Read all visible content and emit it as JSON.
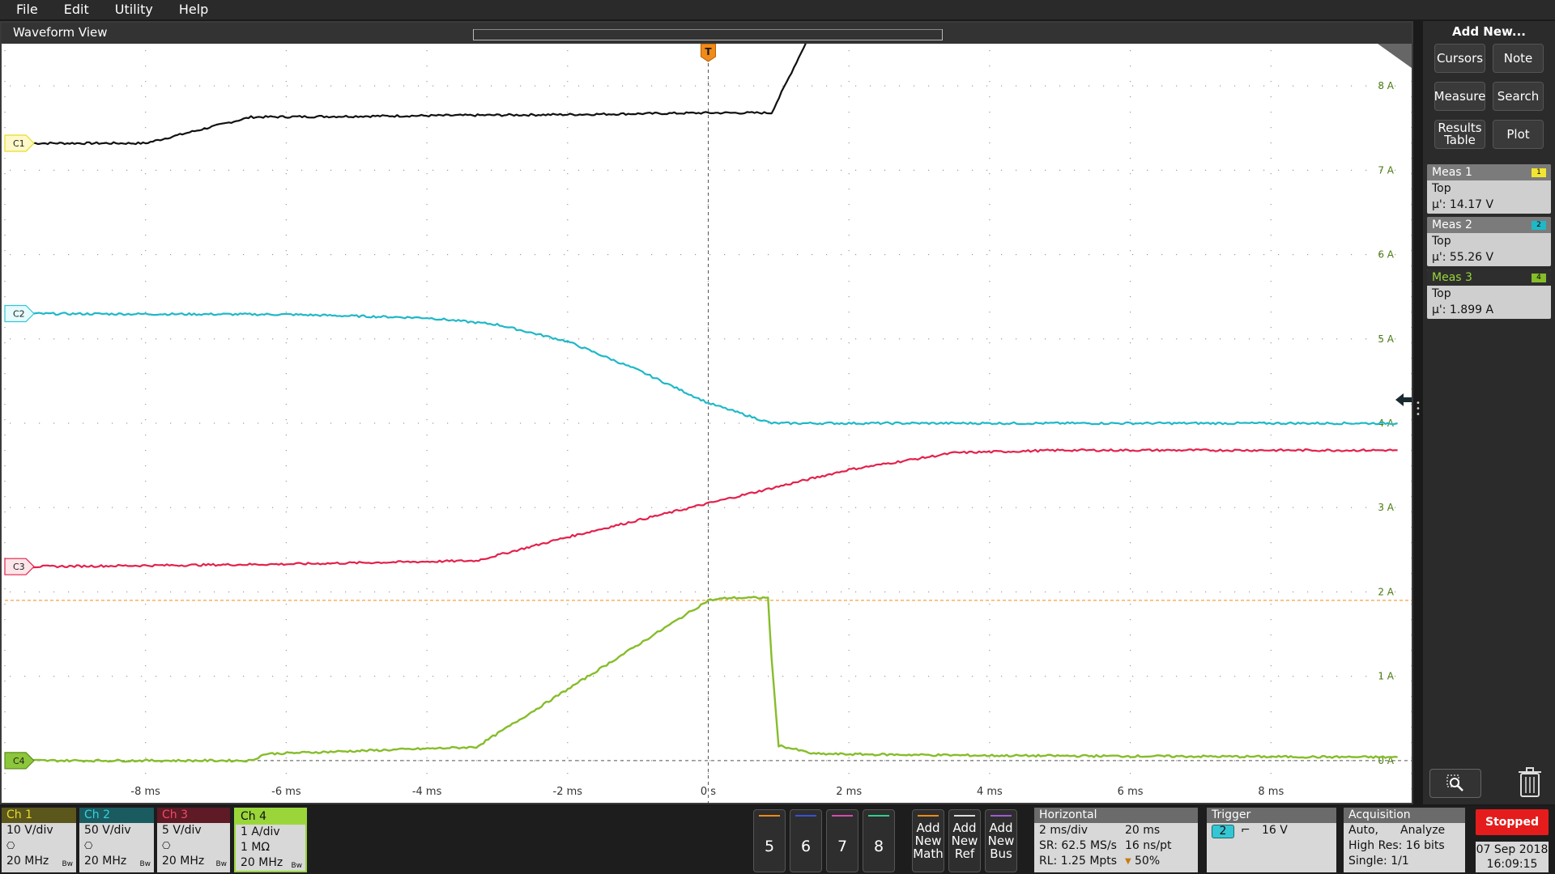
{
  "menu": {
    "items": [
      "File",
      "Edit",
      "Utility",
      "Help"
    ]
  },
  "waveform_view": {
    "title": "Waveform View",
    "trigger_marker": "T",
    "channel_markers": [
      "C1",
      "C2",
      "C3",
      "C4"
    ],
    "colors": {
      "ch1": "#111111",
      "ch2": "#1fb8c7",
      "ch3": "#e3214b",
      "ch4": "#86bd2a",
      "trigger": "#f08a18",
      "grid": "#9a9a9a"
    }
  },
  "chart_data": {
    "type": "line",
    "title": "",
    "xlabel": "",
    "ylabel": "",
    "x_unit": "ms",
    "xlim": [
      -10,
      10
    ],
    "ylim": [
      -0.5,
      8.5
    ],
    "x_tick_labels": [
      "-8 ms",
      "-6 ms",
      "-4 ms",
      "-2 ms",
      "0 s",
      "2 ms",
      "4 ms",
      "6 ms",
      "8 ms"
    ],
    "x_ticks": [
      -8,
      -6,
      -4,
      -2,
      0,
      2,
      4,
      6,
      8
    ],
    "y_tick_labels": [
      "0 A",
      "1 A",
      "2 A",
      "3 A",
      "4 A",
      "5 A",
      "6 A",
      "7 A",
      "8 A"
    ],
    "y_ticks": [
      0,
      1,
      2,
      3,
      4,
      5,
      6,
      7,
      8
    ],
    "grid": true,
    "trigger_level_y": 1.9,
    "series": [
      {
        "name": "C1",
        "color": "#111111",
        "x": [
          -9.6,
          -8,
          -6.5,
          -2,
          0,
          0.9,
          1.5,
          3,
          9.8
        ],
        "y": [
          7.32,
          7.32,
          7.63,
          7.66,
          7.68,
          7.68,
          8.7,
          8.72,
          8.72
        ]
      },
      {
        "name": "C2",
        "color": "#1fb8c7",
        "x": [
          -10,
          -6,
          -4,
          -3,
          -2,
          -1,
          0,
          0.9,
          2,
          9.8
        ],
        "y": [
          5.3,
          5.29,
          5.25,
          5.17,
          4.97,
          4.63,
          4.24,
          4.0,
          4.0,
          4.0
        ]
      },
      {
        "name": "C3",
        "color": "#e3214b",
        "x": [
          -9.6,
          -6,
          -3.3,
          -2,
          0,
          2,
          3.5,
          5,
          9.8
        ],
        "y": [
          2.3,
          2.33,
          2.37,
          2.65,
          3.05,
          3.45,
          3.65,
          3.68,
          3.68
        ]
      },
      {
        "name": "C4",
        "color": "#86bd2a",
        "x": [
          -9.6,
          -6.5,
          -6.3,
          -3.3,
          0,
          0.3,
          0.85,
          0.9,
          1.0,
          1.5,
          4,
          9.8
        ],
        "y": [
          0.0,
          0.0,
          0.08,
          0.16,
          1.9,
          1.93,
          1.93,
          1.2,
          0.18,
          0.08,
          0.06,
          0.04
        ]
      }
    ]
  },
  "right_panel": {
    "title": "Add New...",
    "buttons": [
      "Cursors",
      "Note",
      "Measure",
      "Search",
      "Results Table",
      "Plot"
    ],
    "measurements": [
      {
        "title": "Meas 1",
        "badge": "1",
        "badge_color": "#f2e531",
        "name": "Top",
        "value": "µ': 14.17 V"
      },
      {
        "title": "Meas 2",
        "badge": "2",
        "badge_color": "#1fb8c7",
        "name": "Top",
        "value": "µ': 55.26 V"
      },
      {
        "title": "Meas 3",
        "badge": "4",
        "badge_color": "#86bd2a",
        "name": "Top",
        "value": "µ': 1.899 A"
      }
    ]
  },
  "channels": [
    {
      "label": "Ch 1",
      "color": "#d8cd2a",
      "scale": "10 V/div",
      "line2": "",
      "bw": "20 MHz",
      "bw_tag": "Bw"
    },
    {
      "label": "Ch 2",
      "color": "#1fb8c7",
      "scale": "50 V/div",
      "line2": "",
      "bw": "20 MHz",
      "bw_tag": "Bw"
    },
    {
      "label": "Ch 3",
      "color": "#e3214b",
      "scale": "5 V/div",
      "line2": "",
      "bw": "20 MHz",
      "bw_tag": "Bw"
    },
    {
      "label": "Ch 4",
      "color": "#86bd2a",
      "scale": "1 A/div",
      "line2": "1 MΩ",
      "bw": "20 MHz",
      "bw_tag": "Bw"
    }
  ],
  "num_buttons": [
    {
      "label": "5",
      "color": "#f08a18"
    },
    {
      "label": "6",
      "color": "#3b4fd6"
    },
    {
      "label": "7",
      "color": "#d84ab0"
    },
    {
      "label": "8",
      "color": "#2ed08c"
    }
  ],
  "add_buttons": [
    {
      "l1": "Add",
      "l2": "New",
      "l3": "Math",
      "color": "#f08a18"
    },
    {
      "l1": "Add",
      "l2": "New",
      "l3": "Ref",
      "color": "#dddddd"
    },
    {
      "l1": "Add",
      "l2": "New",
      "l3": "Bus",
      "color": "#a259d6"
    }
  ],
  "horizontal": {
    "title": "Horizontal",
    "scale": "2 ms/div",
    "duration": "20 ms",
    "sr": "SR: 62.5 MS/s",
    "pt": "16 ns/pt",
    "rl": "RL: 1.25 Mpts",
    "pos": "50%"
  },
  "trigger": {
    "title": "Trigger",
    "source": "2",
    "level": "16 V"
  },
  "acquisition": {
    "title": "Acquisition",
    "mode": "Auto,",
    "action": "Analyze",
    "res": "High Res: 16 bits",
    "single": "Single: 1/1"
  },
  "status": {
    "state": "Stopped",
    "date": "07 Sep 2018",
    "time": "16:09:15"
  }
}
